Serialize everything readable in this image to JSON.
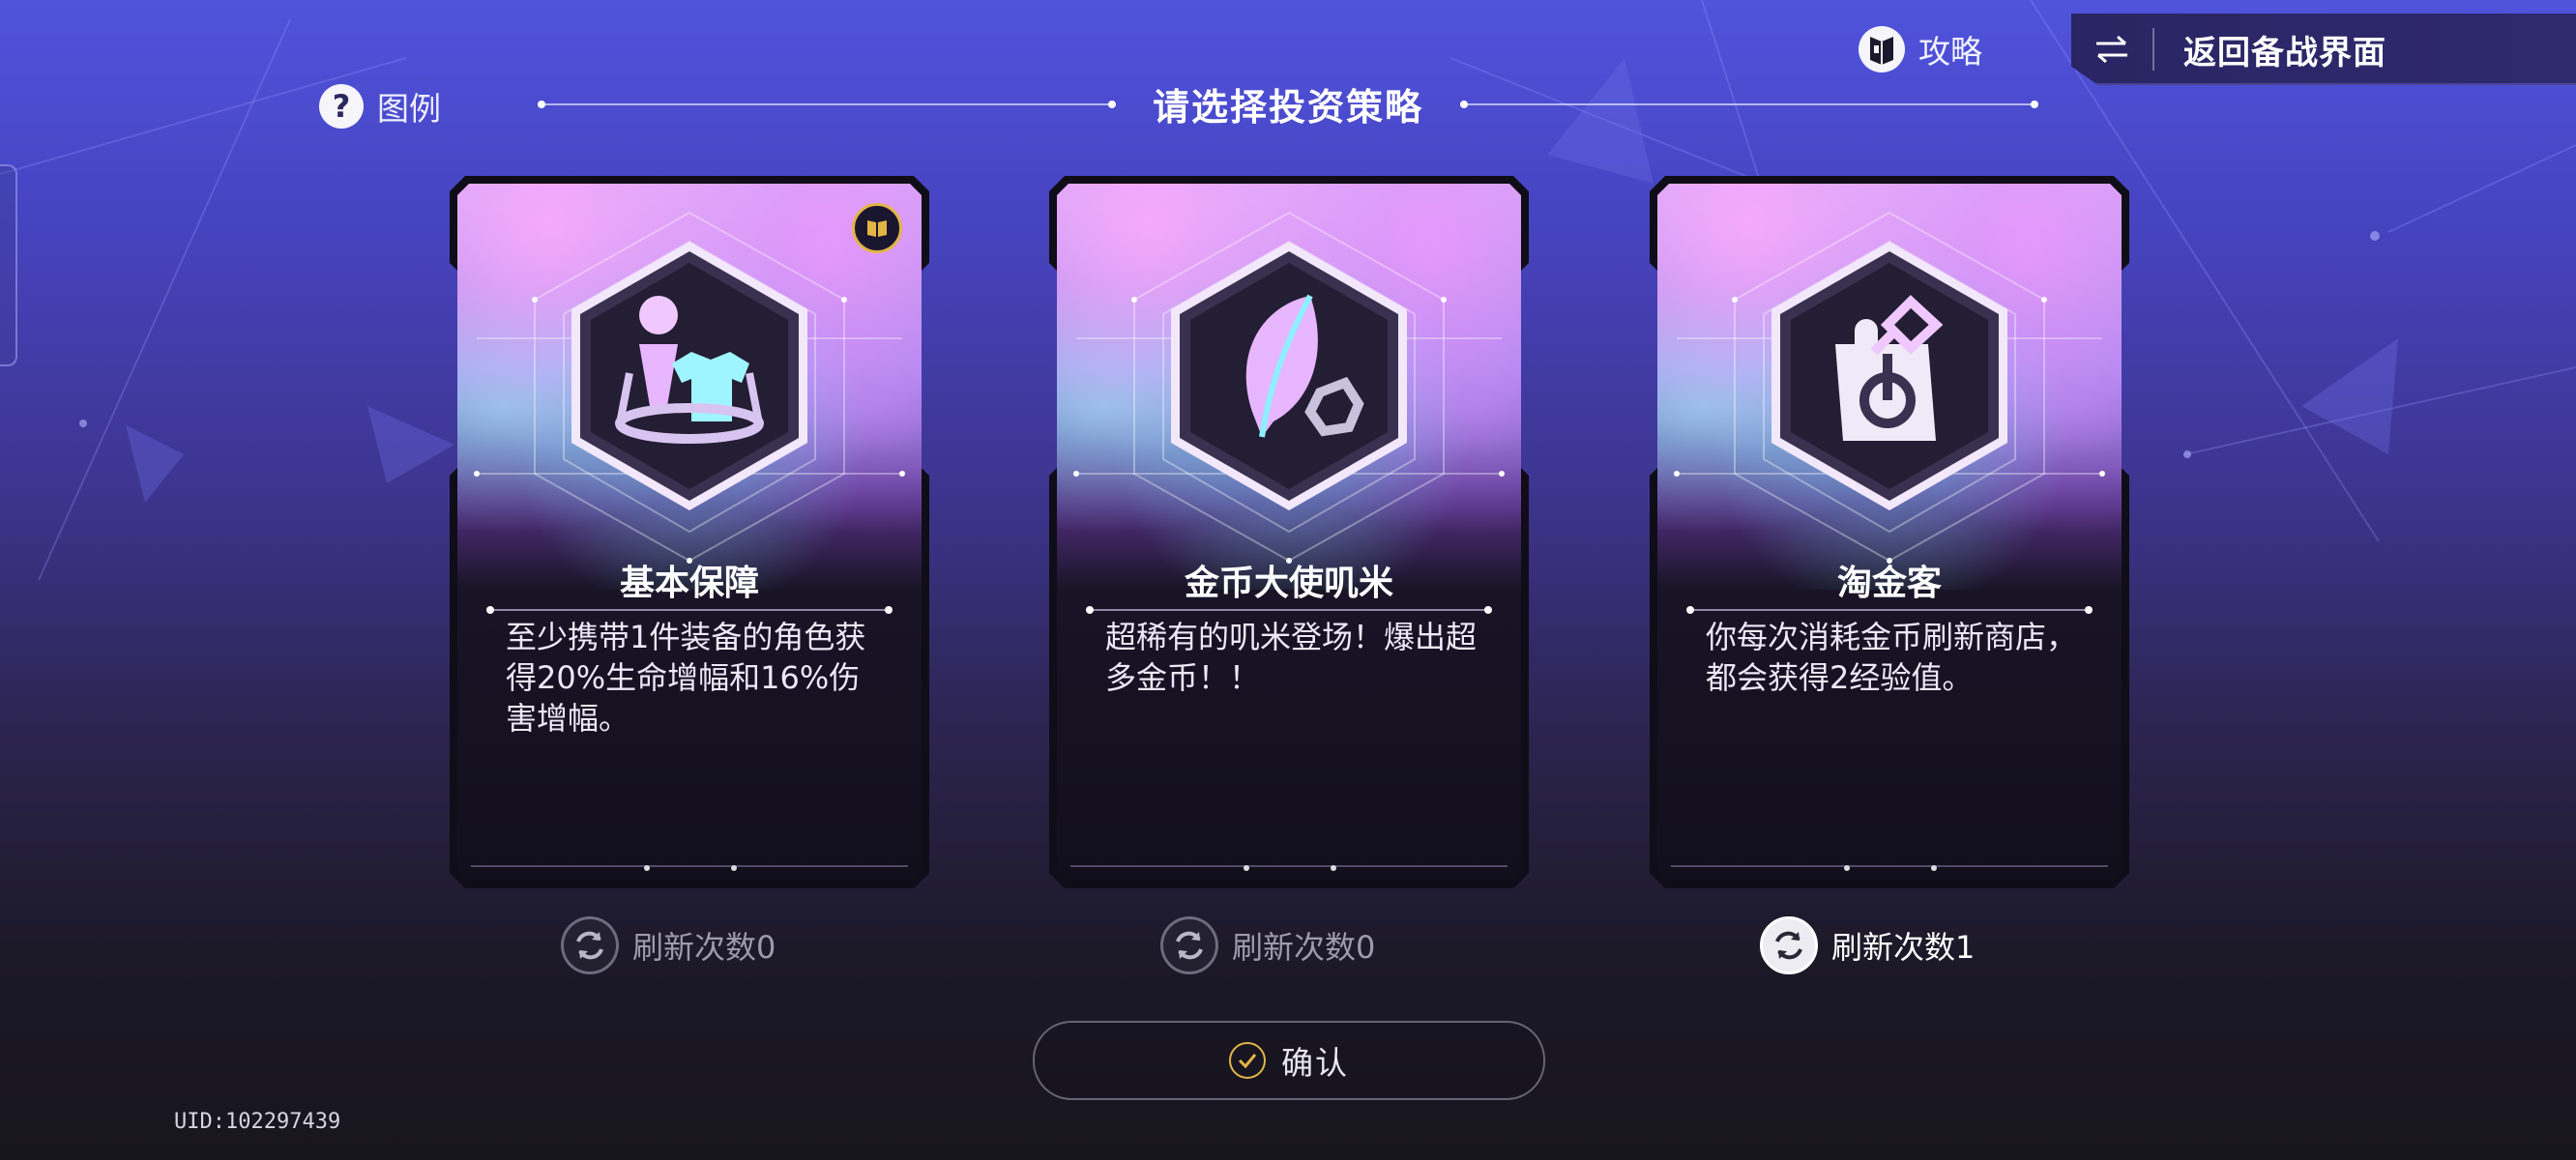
{
  "header": {
    "guide_label": "攻略",
    "back_label": "返回备战界面",
    "legend_label": "图例",
    "title": "请选择投资策略"
  },
  "cards": [
    {
      "title": "基本保障",
      "desc": "至少携带1件装备的角色获得20%生命增幅和16%伤害增幅。",
      "icon": "character-equipment-icon",
      "has_badge": true,
      "refresh_label": "刷新次数0",
      "refresh_active": false
    },
    {
      "title": "金币大使叽米",
      "desc": "超稀有的叽米登场！爆出超多金币！！",
      "icon": "feather-coin-icon",
      "has_badge": false,
      "refresh_label": "刷新次数0",
      "refresh_active": false
    },
    {
      "title": "淘金客",
      "desc": "你每次消耗金币刷新商店，都会获得2经验值。",
      "icon": "shopping-bag-icon",
      "has_badge": false,
      "refresh_label": "刷新次数1",
      "refresh_active": true
    }
  ],
  "confirm_label": "确认",
  "uid": "UID:102297439",
  "colors": {
    "accent_gold": "#e2b545",
    "frame": "#0f0d17"
  }
}
